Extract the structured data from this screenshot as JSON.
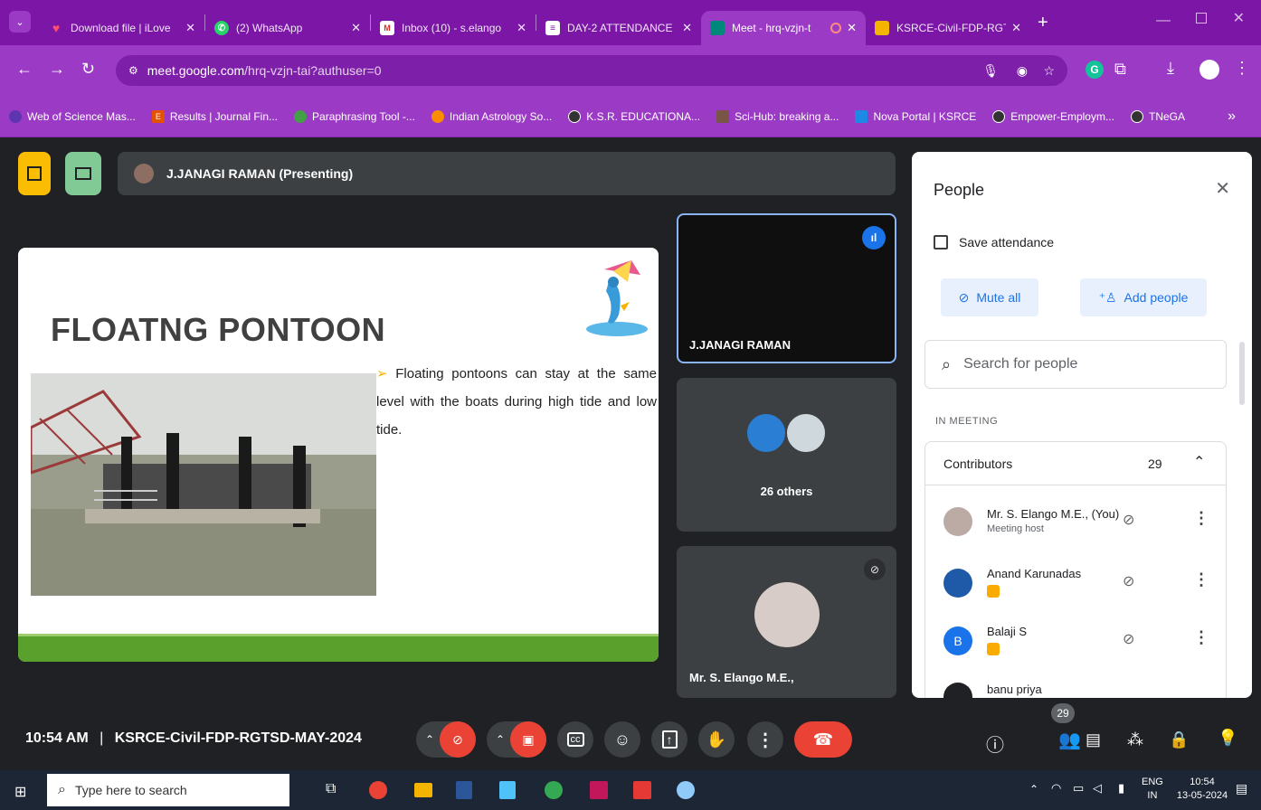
{
  "tabs": [
    {
      "label": "Download file | iLove",
      "color": "#e0245e"
    },
    {
      "label": "(2) WhatsApp",
      "color": "#25d366"
    },
    {
      "label": "Inbox (10) - s.elango",
      "color": "#1a73e8"
    },
    {
      "label": "DAY-2 ATTENDANCE",
      "color": "#0f9d58"
    },
    {
      "label": "Meet - hrq-vzjn-t",
      "color": "#00897b"
    },
    {
      "label": "KSRCE-Civil-FDP-RGT",
      "color": "#f4b400"
    }
  ],
  "address": {
    "host": "meet.google.com",
    "path": "/hrq-vzjn-tai?authuser=0"
  },
  "bookmarks": [
    {
      "label": "Web of Science Mas...",
      "color": "#5e35b1"
    },
    {
      "label": "Results | Journal Fin...",
      "color": "#e65100"
    },
    {
      "label": "Paraphrasing Tool -...",
      "color": "#43a047"
    },
    {
      "label": "Indian Astrology So...",
      "color": "#fb8c00"
    },
    {
      "label": "K.S.R. EDUCATIONA...",
      "color": "#333333"
    },
    {
      "label": "Sci-Hub: breaking a...",
      "color": "#795548"
    },
    {
      "label": "Nova Portal | KSRCE",
      "color": "#1e88e5"
    },
    {
      "label": "Empower-Employm...",
      "color": "#333333"
    },
    {
      "label": "TNeGA",
      "color": "#333333"
    }
  ],
  "bookmarks_more": "»",
  "meet": {
    "presenter_label": "J.JANAGI RAMAN (Presenting)",
    "slide": {
      "title": "FLOATNG PONTOON",
      "bullet": "Floating pontoons can stay at the same level with the boats during high tide and low tide."
    },
    "tiles": {
      "main_name": "J.JANAGI RAMAN",
      "others_label": "26 others",
      "self_name": "Mr. S. Elango M.E.,"
    },
    "meeting_time": "10:54 AM",
    "meeting_sep": "|",
    "meeting_name": "KSRCE-Civil-FDP-RGTSD-MAY-2024",
    "participant_count": "29"
  },
  "people_panel": {
    "title": "People",
    "save_attendance": "Save attendance",
    "mute_all": "Mute all",
    "add_people": "Add people",
    "search_placeholder": "Search for people",
    "section_label": "IN MEETING",
    "contributors_label": "Contributors",
    "contributors_count": "29",
    "people": [
      {
        "name": "Mr. S. Elango M.E., (You)",
        "sub": "Meeting host",
        "avatar": "photo"
      },
      {
        "name": "Anand Karunadas",
        "sub": "",
        "avatar": "photo"
      },
      {
        "name": "Balaji S",
        "sub": "",
        "avatar": "B"
      },
      {
        "name": "banu priya",
        "sub": "",
        "avatar": "photo"
      }
    ]
  },
  "taskbar": {
    "search_placeholder": "Type here to search",
    "lang_top": "ENG",
    "lang_bottom": "IN",
    "time": "10:54",
    "date": "13-05-2024"
  }
}
